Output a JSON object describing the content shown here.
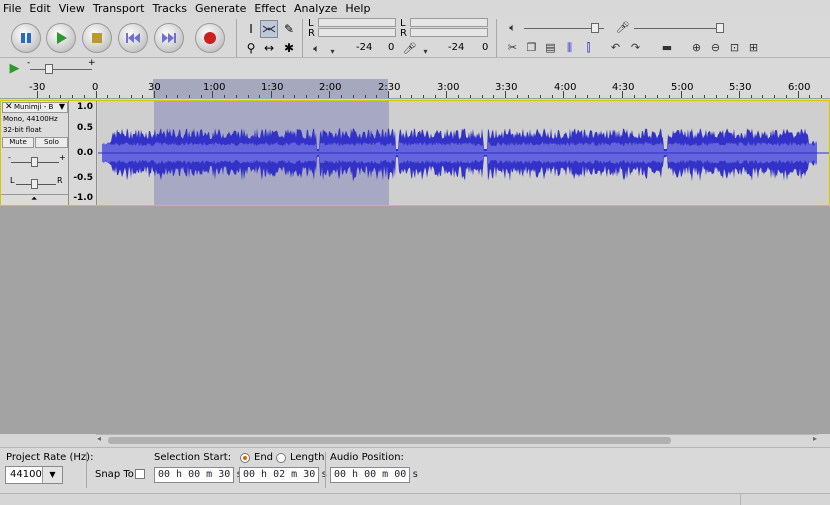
{
  "menu": [
    "File",
    "Edit",
    "View",
    "Transport",
    "Tracks",
    "Generate",
    "Effect",
    "Analyze",
    "Help"
  ],
  "meters": {
    "play": {
      "left_label": "L",
      "right_label": "R",
      "scale_a": "-24",
      "scale_b": "0"
    },
    "record": {
      "left_label": "L",
      "right_label": "R",
      "scale_a": "-24",
      "scale_b": "0"
    }
  },
  "ruler": {
    "labels": [
      "-30",
      "0",
      "30",
      "1:00",
      "1:30",
      "2:00",
      "2:30",
      "3:00",
      "3:30",
      "4:00",
      "4:30",
      "5:00",
      "5:30",
      "6:00"
    ]
  },
  "track": {
    "name": "Munimji - B",
    "info_line1": "Mono, 44100Hz",
    "info_line2": "32-bit float",
    "mute_label": "Mute",
    "solo_label": "Solo",
    "gain_minus": "-",
    "gain_plus": "+",
    "pan_left": "L",
    "pan_right": "R",
    "vruler": [
      "1.0",
      "0.5",
      "0.0",
      "-0.5",
      "-1.0"
    ],
    "waveform_color": "#3232c8",
    "waveform_rms_color": "#6464dc"
  },
  "selection_bar": {
    "project_rate_label": "Project Rate (Hz):",
    "project_rate_value": "44100",
    "snap_to_label": "Snap To",
    "selection_start_label": "Selection Start:",
    "end_label": "End",
    "length_label": "Length",
    "audio_position_label": "Audio Position:",
    "selection_start_value": "00 h 00 m 30 s",
    "selection_end_value": "00 h 02 m 30 s",
    "audio_position_value": "00 h 00 m 00 s"
  },
  "colors": {
    "selection": "#a7a9c4",
    "track_border": "#d6c800",
    "record_red": "#cc2020",
    "play_green": "#2c9a2c"
  }
}
